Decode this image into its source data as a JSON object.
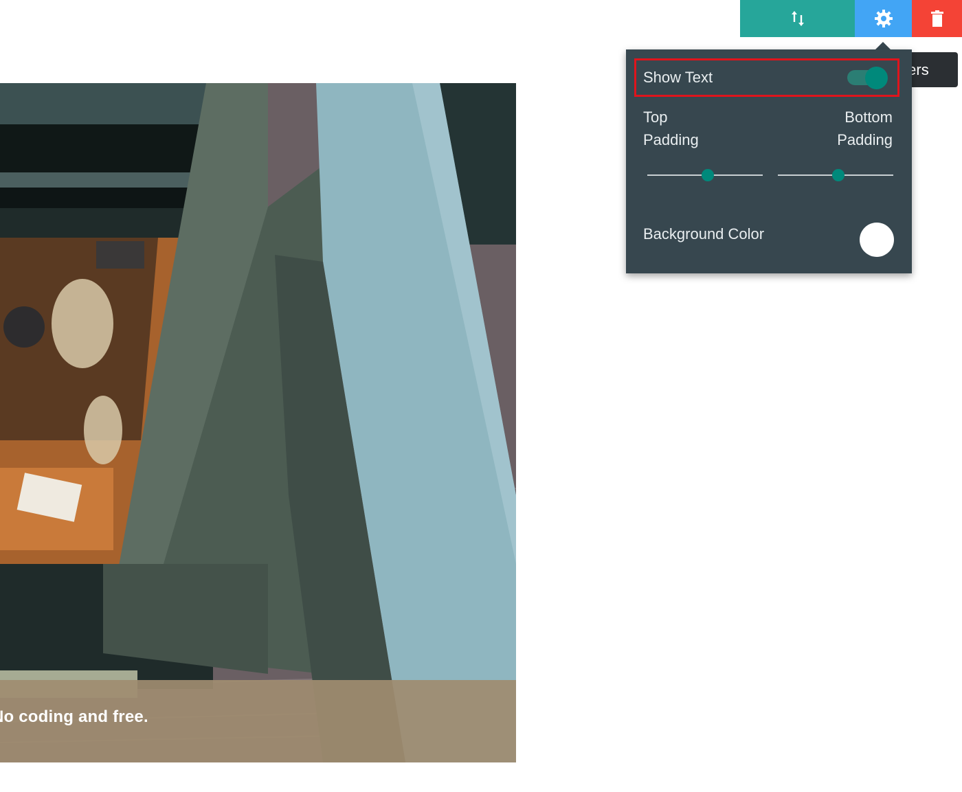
{
  "image": {
    "caption": "No coding and free."
  },
  "toolbar": {
    "move_icon": "move-updown-icon",
    "settings_icon": "gear-icon",
    "delete_icon": "trash-icon",
    "tooltip": "Parameters",
    "colors": {
      "move": "#26a69a",
      "settings": "#42a5f5",
      "delete": "#f44336"
    }
  },
  "settings_panel": {
    "show_text": {
      "label": "Show Text",
      "enabled": true
    },
    "top_padding": {
      "label_line1": "Top",
      "label_line2": "Padding"
    },
    "bottom_padding": {
      "label_line1": "Bottom",
      "label_line2": "Padding"
    },
    "background_color": {
      "label": "Background Color",
      "value": "#ffffff"
    },
    "accent_color": "#00897b",
    "highlight_color": "#e0141c"
  }
}
